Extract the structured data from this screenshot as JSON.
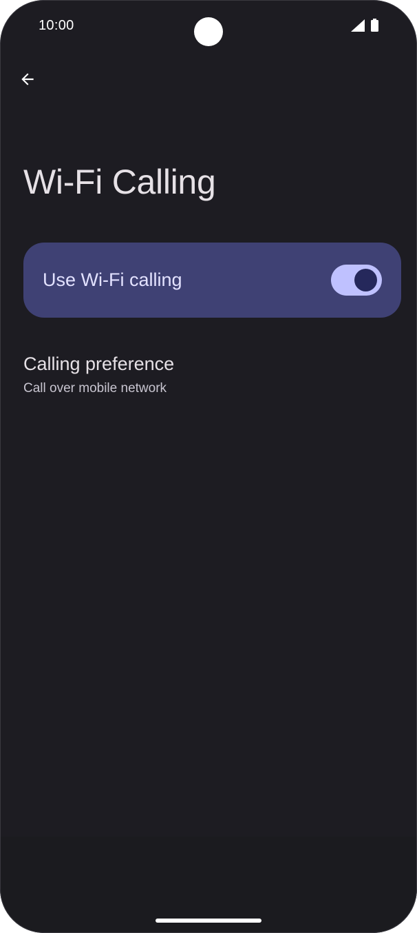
{
  "status_bar": {
    "time": "10:00",
    "icons": [
      "signal-icon",
      "battery-icon"
    ]
  },
  "toolbar": {
    "back_icon": "back-arrow-icon"
  },
  "page": {
    "title": "Wi-Fi Calling"
  },
  "main_switch": {
    "label": "Use Wi-Fi calling",
    "checked": true
  },
  "preferences": [
    {
      "title": "Calling preference",
      "summary": "Call over mobile network"
    }
  ],
  "colors": {
    "background": "#1d1c22",
    "main_switch_card": "#3f4174",
    "switch_track": "#bfc1ff",
    "switch_thumb": "#25285b",
    "title_text": "#e6e1e6",
    "summary_text": "#c8c5d0"
  }
}
